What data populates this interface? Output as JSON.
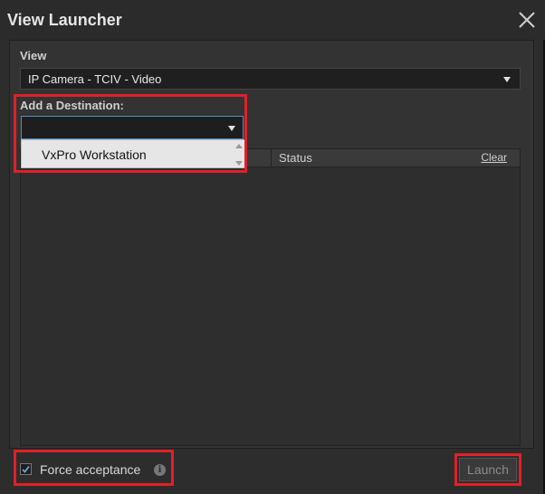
{
  "window": {
    "title": "View Launcher"
  },
  "view": {
    "label": "View",
    "selected": "IP Camera - TCIV - Video"
  },
  "destination": {
    "label": "Add a Destination:",
    "value": "",
    "options": [
      "VxPro Workstation"
    ]
  },
  "list": {
    "status_header": "Status",
    "clear_label": "Clear"
  },
  "footer": {
    "force_label": "Force acceptance",
    "force_checked": true,
    "info_icon": "i",
    "launch_label": "Launch"
  },
  "colors": {
    "highlight": "#e0202a",
    "focus": "#4a90c8"
  }
}
